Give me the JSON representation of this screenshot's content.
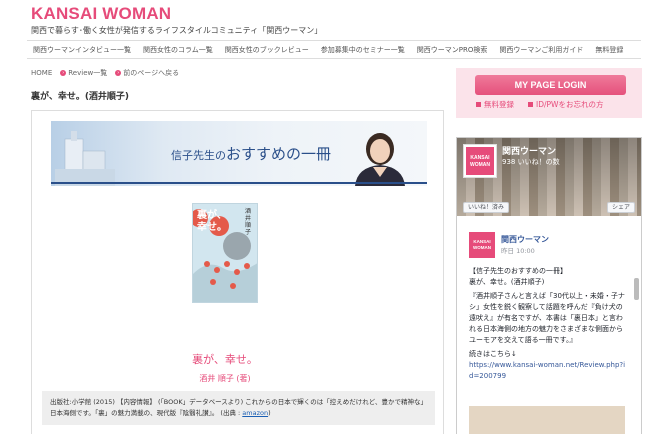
{
  "header": {
    "logo": "KANSAI WOMAN",
    "tagline": "関西で暮らす･働く女性が発信するライフスタイルコミュニティ「関西ウーマン」"
  },
  "gnav": [
    "関西ウーマンインタビュー一覧",
    "関西女性のコラム一覧",
    "関西女性のブックレビュー",
    "参加募集中のセミナー一覧",
    "関西ウーマンPRO検索",
    "関西ウーマンご利用ガイド",
    "無料登録"
  ],
  "breadcrumb": {
    "home": "HOME",
    "review_list": "Review一覧",
    "back": "前のページへ戻る"
  },
  "page_title": "裏が、幸せ。(酒井順子)",
  "banner": {
    "title_prefix": "信子先生の",
    "title_main": "おすすめの一冊"
  },
  "book": {
    "cover_title": "裏が、幸せ。",
    "cover_author": "酒井順子",
    "title": "裏が、幸せ。",
    "author": "酒井 順子 (著)"
  },
  "description": {
    "text": "出版社:小学館 (2015) 【内容情報】 (「BOOK」データベースより) これからの日本で輝くのは「控えめだけれど、豊かで精神な」日本海側です。「裏」の魅力満載の、現代版『陰翳礼讃』。 (出典 : ",
    "link": "amazon",
    "text_end": ")"
  },
  "login": {
    "button": "MY PAGE LOGIN",
    "register": "無料登録",
    "forgot": "ID/PWをお忘れの方"
  },
  "facebook": {
    "page_name": "関西ウーマン",
    "likes": "938 いいね！の数",
    "like_button": "いいね！済み",
    "share_button": "シェア",
    "logo_text_1": "KANSAI",
    "logo_text_2": "WOMAN",
    "post": {
      "name": "関西ウーマン",
      "time": "昨日 10:00",
      "line1": "【信子先生のおすすめの一冊】",
      "line2": "裏が、幸せ。(酒井順子)",
      "line3": "『酒井順子さんと言えば「30代以上・未婚・子ナシ」女性を鋭く観察して話題を呼んだ『負け犬の遠吠え』が有名ですが、本書は「裏日本」と言われる日本海側の地方の魅力をさまざまな側面からユーモアを交えて語る一冊です。』",
      "line4": "続きはこちら↓",
      "link": "https://www.kansai-woman.net/Review.php?id=200799"
    }
  }
}
